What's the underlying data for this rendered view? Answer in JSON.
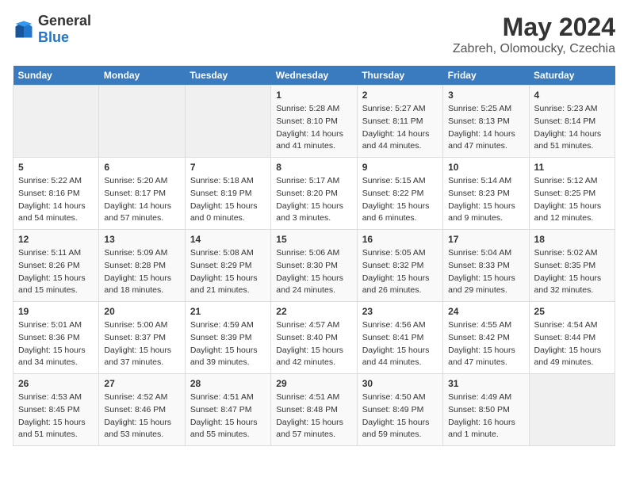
{
  "header": {
    "logo_general": "General",
    "logo_blue": "Blue",
    "title": "May 2024",
    "subtitle": "Zabreh, Olomoucky, Czechia"
  },
  "calendar": {
    "days_of_week": [
      "Sunday",
      "Monday",
      "Tuesday",
      "Wednesday",
      "Thursday",
      "Friday",
      "Saturday"
    ],
    "weeks": [
      [
        {
          "day": "",
          "info": ""
        },
        {
          "day": "",
          "info": ""
        },
        {
          "day": "",
          "info": ""
        },
        {
          "day": "1",
          "info": "Sunrise: 5:28 AM\nSunset: 8:10 PM\nDaylight: 14 hours\nand 41 minutes."
        },
        {
          "day": "2",
          "info": "Sunrise: 5:27 AM\nSunset: 8:11 PM\nDaylight: 14 hours\nand 44 minutes."
        },
        {
          "day": "3",
          "info": "Sunrise: 5:25 AM\nSunset: 8:13 PM\nDaylight: 14 hours\nand 47 minutes."
        },
        {
          "day": "4",
          "info": "Sunrise: 5:23 AM\nSunset: 8:14 PM\nDaylight: 14 hours\nand 51 minutes."
        }
      ],
      [
        {
          "day": "5",
          "info": "Sunrise: 5:22 AM\nSunset: 8:16 PM\nDaylight: 14 hours\nand 54 minutes."
        },
        {
          "day": "6",
          "info": "Sunrise: 5:20 AM\nSunset: 8:17 PM\nDaylight: 14 hours\nand 57 minutes."
        },
        {
          "day": "7",
          "info": "Sunrise: 5:18 AM\nSunset: 8:19 PM\nDaylight: 15 hours\nand 0 minutes."
        },
        {
          "day": "8",
          "info": "Sunrise: 5:17 AM\nSunset: 8:20 PM\nDaylight: 15 hours\nand 3 minutes."
        },
        {
          "day": "9",
          "info": "Sunrise: 5:15 AM\nSunset: 8:22 PM\nDaylight: 15 hours\nand 6 minutes."
        },
        {
          "day": "10",
          "info": "Sunrise: 5:14 AM\nSunset: 8:23 PM\nDaylight: 15 hours\nand 9 minutes."
        },
        {
          "day": "11",
          "info": "Sunrise: 5:12 AM\nSunset: 8:25 PM\nDaylight: 15 hours\nand 12 minutes."
        }
      ],
      [
        {
          "day": "12",
          "info": "Sunrise: 5:11 AM\nSunset: 8:26 PM\nDaylight: 15 hours\nand 15 minutes."
        },
        {
          "day": "13",
          "info": "Sunrise: 5:09 AM\nSunset: 8:28 PM\nDaylight: 15 hours\nand 18 minutes."
        },
        {
          "day": "14",
          "info": "Sunrise: 5:08 AM\nSunset: 8:29 PM\nDaylight: 15 hours\nand 21 minutes."
        },
        {
          "day": "15",
          "info": "Sunrise: 5:06 AM\nSunset: 8:30 PM\nDaylight: 15 hours\nand 24 minutes."
        },
        {
          "day": "16",
          "info": "Sunrise: 5:05 AM\nSunset: 8:32 PM\nDaylight: 15 hours\nand 26 minutes."
        },
        {
          "day": "17",
          "info": "Sunrise: 5:04 AM\nSunset: 8:33 PM\nDaylight: 15 hours\nand 29 minutes."
        },
        {
          "day": "18",
          "info": "Sunrise: 5:02 AM\nSunset: 8:35 PM\nDaylight: 15 hours\nand 32 minutes."
        }
      ],
      [
        {
          "day": "19",
          "info": "Sunrise: 5:01 AM\nSunset: 8:36 PM\nDaylight: 15 hours\nand 34 minutes."
        },
        {
          "day": "20",
          "info": "Sunrise: 5:00 AM\nSunset: 8:37 PM\nDaylight: 15 hours\nand 37 minutes."
        },
        {
          "day": "21",
          "info": "Sunrise: 4:59 AM\nSunset: 8:39 PM\nDaylight: 15 hours\nand 39 minutes."
        },
        {
          "day": "22",
          "info": "Sunrise: 4:57 AM\nSunset: 8:40 PM\nDaylight: 15 hours\nand 42 minutes."
        },
        {
          "day": "23",
          "info": "Sunrise: 4:56 AM\nSunset: 8:41 PM\nDaylight: 15 hours\nand 44 minutes."
        },
        {
          "day": "24",
          "info": "Sunrise: 4:55 AM\nSunset: 8:42 PM\nDaylight: 15 hours\nand 47 minutes."
        },
        {
          "day": "25",
          "info": "Sunrise: 4:54 AM\nSunset: 8:44 PM\nDaylight: 15 hours\nand 49 minutes."
        }
      ],
      [
        {
          "day": "26",
          "info": "Sunrise: 4:53 AM\nSunset: 8:45 PM\nDaylight: 15 hours\nand 51 minutes."
        },
        {
          "day": "27",
          "info": "Sunrise: 4:52 AM\nSunset: 8:46 PM\nDaylight: 15 hours\nand 53 minutes."
        },
        {
          "day": "28",
          "info": "Sunrise: 4:51 AM\nSunset: 8:47 PM\nDaylight: 15 hours\nand 55 minutes."
        },
        {
          "day": "29",
          "info": "Sunrise: 4:51 AM\nSunset: 8:48 PM\nDaylight: 15 hours\nand 57 minutes."
        },
        {
          "day": "30",
          "info": "Sunrise: 4:50 AM\nSunset: 8:49 PM\nDaylight: 15 hours\nand 59 minutes."
        },
        {
          "day": "31",
          "info": "Sunrise: 4:49 AM\nSunset: 8:50 PM\nDaylight: 16 hours\nand 1 minute."
        },
        {
          "day": "",
          "info": ""
        }
      ]
    ]
  }
}
